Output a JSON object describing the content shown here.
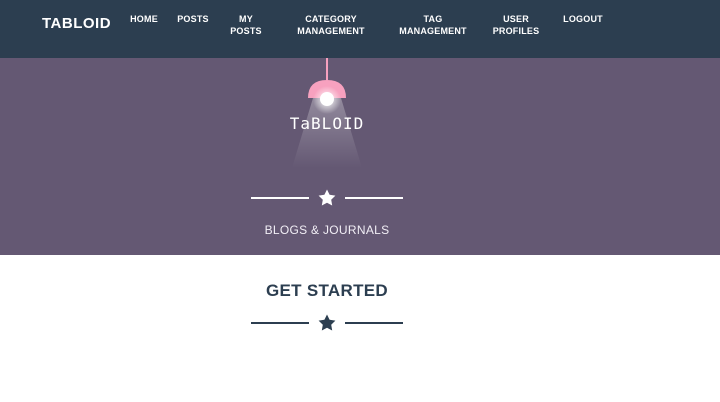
{
  "navbar": {
    "brand": "TABLOID",
    "items": [
      {
        "label": "HOME"
      },
      {
        "label": "POSTS"
      },
      {
        "label": "MY\nPOSTS"
      },
      {
        "label": "CATEGORY\nMANAGEMENT"
      },
      {
        "label": "TAG\nMANAGEMENT"
      },
      {
        "label": "USER\nPROFILES"
      },
      {
        "label": "LOGOUT"
      }
    ]
  },
  "hero": {
    "logo_text": "TaBLOID",
    "subtitle": "BLOGS & JOURNALS",
    "icons": {
      "lamp": "ceiling-lamp-icon",
      "divider": "star-icon"
    }
  },
  "section": {
    "title": "GET STARTED",
    "icons": {
      "divider": "star-icon"
    }
  },
  "colors": {
    "navbar_bg": "#2c3e50",
    "hero_bg": "#645873",
    "lamp_shade": "#f7a1bf",
    "text_light": "#ffffff",
    "text_dark": "#2c3e50"
  }
}
